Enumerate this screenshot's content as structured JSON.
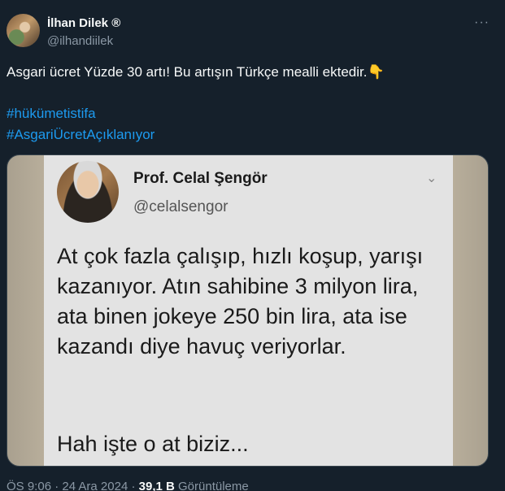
{
  "author": {
    "name": "İlhan Dilek ®",
    "handle": "@ilhandiilek"
  },
  "more_icon": "···",
  "tweet": {
    "text": "Asgari ücret Yüzde 30 artı! Bu artışın Türkçe mealli ektedir.👇",
    "hashtags": [
      "#hükümetistifa",
      "#AsgariÜcretAçıklanıyor"
    ]
  },
  "quoted_card": {
    "name": "Prof. Celal Şengör",
    "handle": "@celalsengor",
    "chevron_icon": "⌄",
    "body": "At çok fazla çalışıp, hızlı koşup, yarışı kazanıyor. Atın sahibine 3 milyon lira, ata binen jokeye 250 bin lira, ata ise kazandı diye havuç veriyorlar.",
    "body_end": "Hah işte o at biziz..."
  },
  "meta": {
    "time": "ÖS 9:06",
    "date": "24 Ara 2024",
    "views_count": "39,1 B",
    "views_label": "Görüntüleme"
  }
}
